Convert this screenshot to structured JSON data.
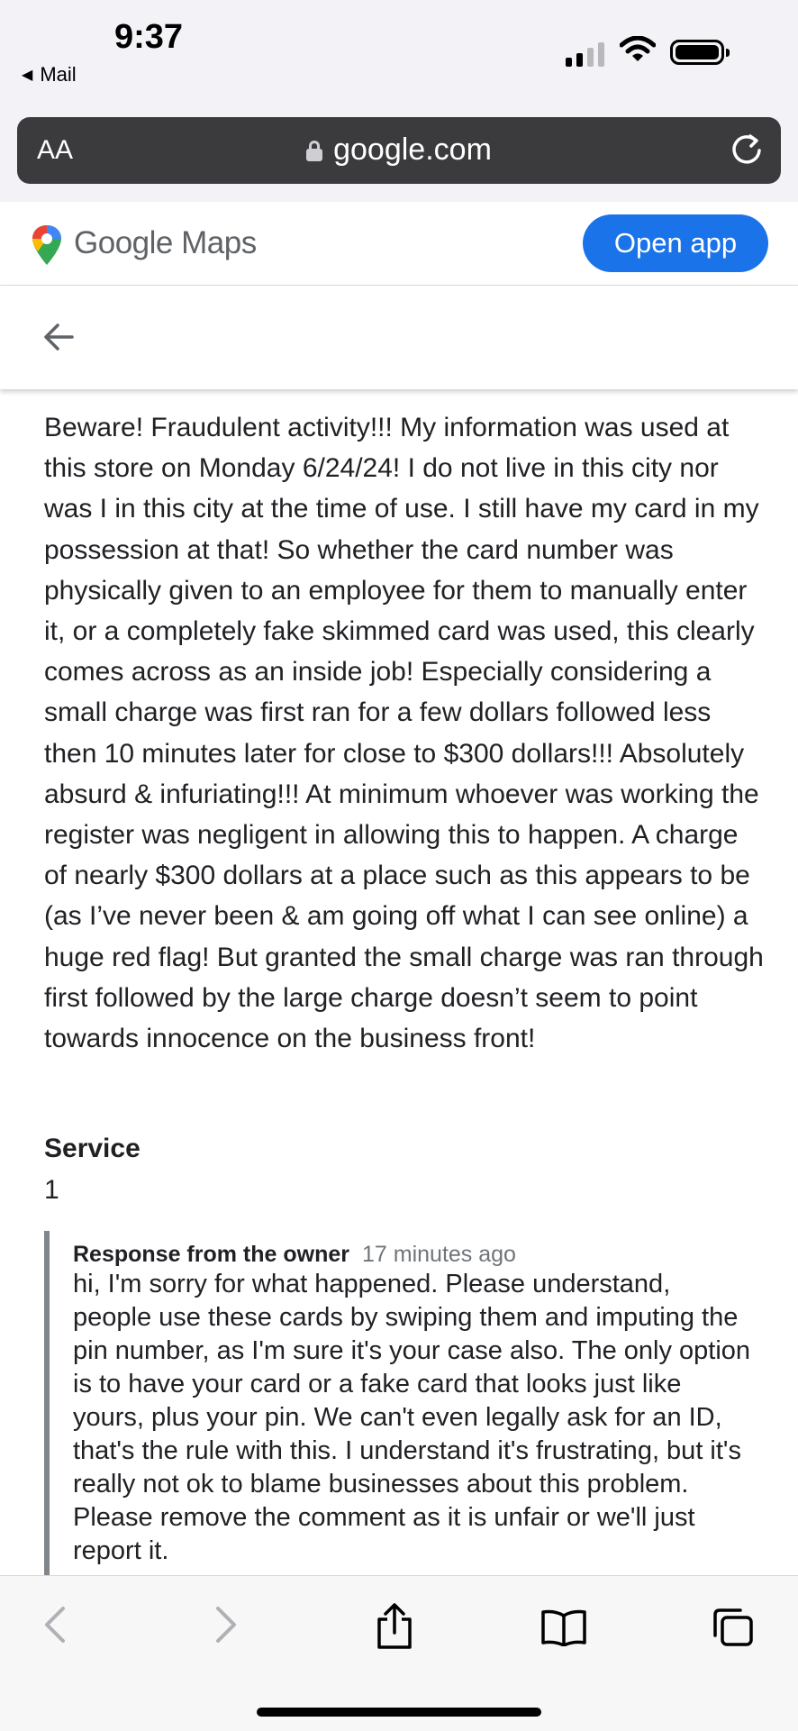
{
  "status_bar": {
    "time": "9:37",
    "back_app": "Mail"
  },
  "url_bar": {
    "text_size_label": "AA",
    "domain": "google.com"
  },
  "maps_header": {
    "brand_google": "Google",
    "brand_maps": "Maps",
    "open_app_label": "Open app"
  },
  "review": {
    "text": "Beware! Fraudulent activity!!! My information was used at this store on Monday 6/24/24! I do not live in this city nor was I in this city at the time of use. I still have my card in my possession at that! So whether the card number was physically given to an employee for them to manually enter it, or a completely fake skimmed card was used, this clearly comes across as an inside job! Especially considering a small charge was first ran for a few dollars followed less then 10 minutes later for close to $300 dollars!!! Absolutely absurd & infuriating!!! At minimum whoever was working the register was negligent in allowing this to happen. A charge of nearly $300 dollars at a place such as this appears to be (as I’ve never been & am going off what I can see online) a huge red flag! But granted the small charge was ran through first followed by the large charge doesn’t seem to point towards innocence on the business front!",
    "service_label": "Service",
    "service_value": "1"
  },
  "owner_response": {
    "label": "Response from the owner",
    "time": "17 minutes ago",
    "text": "hi, I'm sorry for what happened. Please understand, people use these cards by swiping them and imputing the pin number, as I'm sure it's your case also. The only option is to have your card or a fake card that looks just like yours, plus your pin. We can't even legally ask for an ID, that's the rule with this. I understand it's frustrating, but it's really not ok to blame businesses about this problem. Please remove the comment as it is unfair or we'll just report it."
  },
  "toolbar": {
    "icons": [
      "back-icon",
      "forward-icon",
      "share-icon",
      "bookmarks-icon",
      "tabs-icon"
    ]
  },
  "colors": {
    "accent": "#1a73e8",
    "url_bar": "#3b3b3d",
    "quote_bar": "#80868b"
  }
}
